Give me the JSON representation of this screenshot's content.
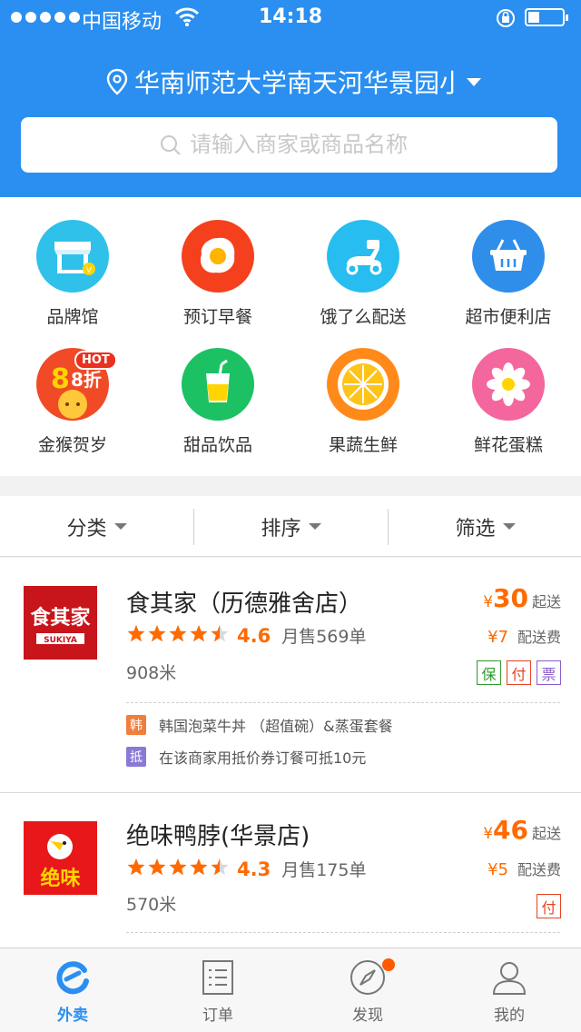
{
  "status_bar": {
    "carrier": "中国移动",
    "time": "14:18"
  },
  "header": {
    "location": "华南师范大学南天河华景园小区",
    "search_placeholder": "请输入商家或商品名称"
  },
  "categories": [
    {
      "label": "品牌馆",
      "icon": "storefront-icon",
      "color": "#2fc1ea"
    },
    {
      "label": "预订早餐",
      "icon": "fried-egg-icon",
      "color": "#f4401c"
    },
    {
      "label": "饿了么配送",
      "icon": "scooter-icon",
      "color": "#27bdf0"
    },
    {
      "label": "超市便利店",
      "icon": "basket-icon",
      "color": "#2e8ee9"
    },
    {
      "label": "金猴贺岁",
      "icon": "monkey-discount-icon",
      "color": "#f04a26",
      "badge": "HOT",
      "promo": "8折"
    },
    {
      "label": "甜品饮品",
      "icon": "drink-cup-icon",
      "color": "#1cc163"
    },
    {
      "label": "果蔬生鲜",
      "icon": "orange-slice-icon",
      "color": "#ff8a1a"
    },
    {
      "label": "鲜花蛋糕",
      "icon": "flower-icon",
      "color": "#f4669e"
    }
  ],
  "filters": [
    "分类",
    "排序",
    "筛选"
  ],
  "shops": [
    {
      "name": "食其家（历德雅舍店）",
      "logo_text": "食其家",
      "logo_sub": "SUKIYA",
      "stars": 4.5,
      "rating": "4.6",
      "sales": "月售569单",
      "distance": "908米",
      "min_price": "30",
      "min_label": "起送",
      "delivery_fee": "¥7",
      "delivery_label": "配送费",
      "badges": [
        "保",
        "付",
        "票"
      ],
      "promos": [
        {
          "tag": "韩",
          "color": "#f07e3c",
          "text": "韩国泡菜牛丼 （超值碗）&蒸蛋套餐"
        },
        {
          "tag": "抵",
          "color": "#8a79d6",
          "text": "在该商家用抵价券订餐可抵10元"
        }
      ]
    },
    {
      "name": "绝味鸭脖(华景店)",
      "logo_text": "绝味",
      "stars": 4.5,
      "rating": "4.3",
      "sales": "月售175单",
      "distance": "570米",
      "min_price": "46",
      "min_label": "起送",
      "delivery_fee": "¥5",
      "delivery_label": "配送费",
      "badges": [
        "付"
      ]
    }
  ],
  "currency_symbol": "¥",
  "tabs": [
    {
      "label": "外卖",
      "icon": "eleme-logo-icon",
      "active": true
    },
    {
      "label": "订单",
      "icon": "order-list-icon",
      "active": false
    },
    {
      "label": "发现",
      "icon": "compass-icon",
      "active": false
    },
    {
      "label": "我的",
      "icon": "profile-icon",
      "active": false
    }
  ],
  "colors": {
    "brand": "#2a8ff0",
    "price": "#ff6a00"
  }
}
